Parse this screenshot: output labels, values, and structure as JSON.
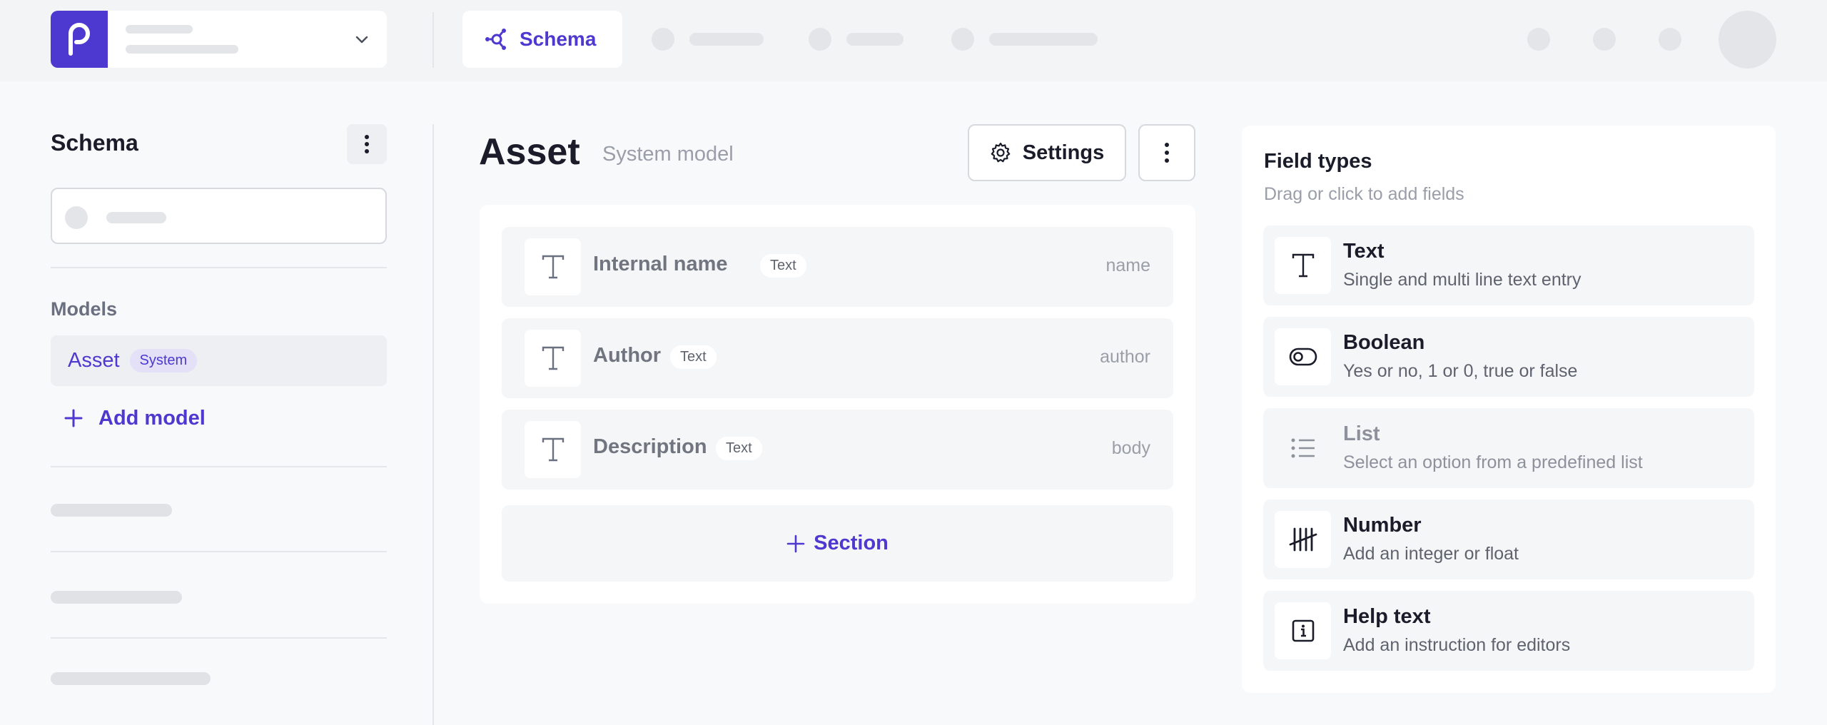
{
  "colors": {
    "accent": "#4d39d0",
    "background": "#f8f9fb",
    "topbar": "#f3f4f6"
  },
  "topbar": {
    "active_tab": {
      "label": "Schema",
      "icon": "schema-graph-icon"
    }
  },
  "sidebar": {
    "title": "Schema",
    "models_heading": "Models",
    "models": [
      {
        "name": "Asset",
        "badge": "System"
      }
    ],
    "add_model_label": "Add model"
  },
  "main": {
    "title": "Asset",
    "subtitle": "System model",
    "settings_label": "Settings",
    "fields": [
      {
        "name": "Internal name",
        "type": "Text",
        "key": "name"
      },
      {
        "name": "Author",
        "type": "Text",
        "key": "author"
      },
      {
        "name": "Description",
        "type": "Text",
        "key": "body"
      }
    ],
    "section_label": "Section"
  },
  "field_types": {
    "title": "Field types",
    "subtitle": "Drag or click to add fields",
    "items": [
      {
        "name": "Text",
        "description": "Single and multi line text entry",
        "icon": "text-t-icon",
        "enabled": true
      },
      {
        "name": "Boolean",
        "description": "Yes or no, 1 or 0, true or false",
        "icon": "toggle-icon",
        "enabled": true
      },
      {
        "name": "List",
        "description": "Select an option from a predefined list",
        "icon": "list-icon",
        "enabled": false
      },
      {
        "name": "Number",
        "description": "Add an integer or float",
        "icon": "tally-icon",
        "enabled": true
      },
      {
        "name": "Help text",
        "description": "Add an instruction for editors",
        "icon": "info-icon",
        "enabled": true
      }
    ]
  }
}
